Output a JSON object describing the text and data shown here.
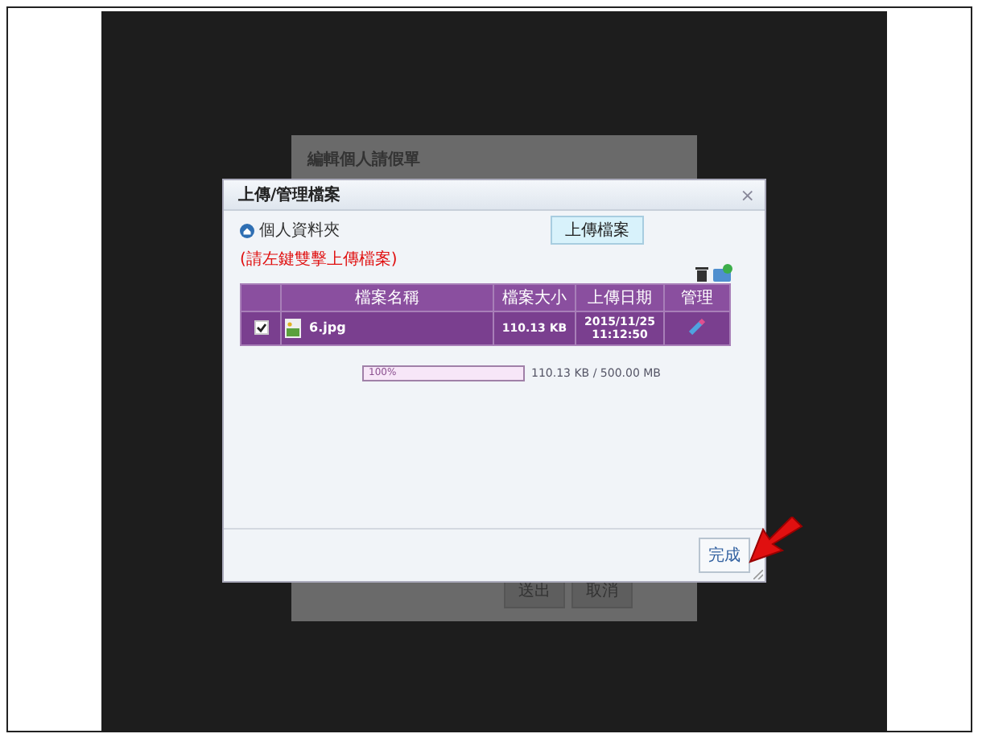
{
  "background_dialog": {
    "title": "編輯個人請假單",
    "buttons": [
      "送出",
      "取消"
    ]
  },
  "dialog": {
    "title": "上傳/管理檔案",
    "close": "×",
    "folder": "個人資料夾",
    "upload_button": "上傳檔案",
    "hint": "(請左鍵雙擊上傳檔案)",
    "table": {
      "columns": [
        "檔案名稱",
        "檔案大小",
        "上傳日期",
        "管理"
      ],
      "rows": [
        {
          "checked": true,
          "name": "6.jpg",
          "size": "110.13 KB",
          "date": "2015/11/25 11:12:50"
        }
      ]
    },
    "quota": {
      "level": 1,
      "label": "100%",
      "reading": "110.13 KB / 500.00 MB"
    },
    "done_button": "完成"
  }
}
